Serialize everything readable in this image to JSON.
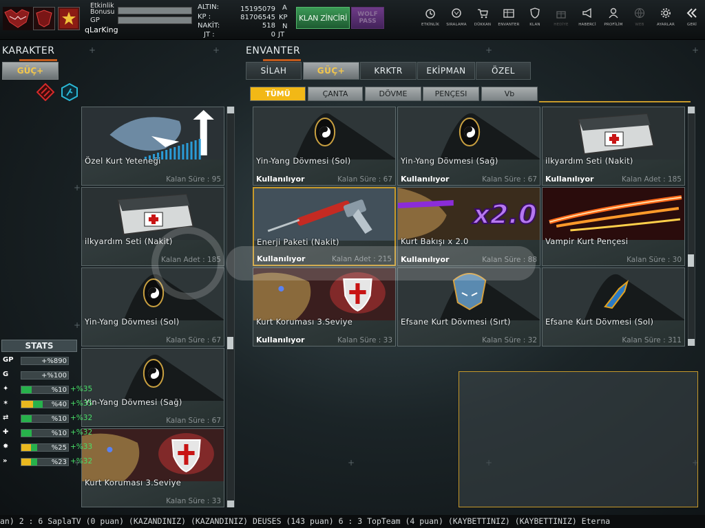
{
  "top": {
    "username": "qLarKing",
    "bonus_label_1": "Etkinlik",
    "bonus_label_2": "Bonusu",
    "gp_label": "GP",
    "currencies": [
      {
        "label": "ALTIN:",
        "value": "15195079",
        "unit": "A"
      },
      {
        "label": "KP :",
        "value": "81706545",
        "unit": "KP"
      },
      {
        "label": "NAKİT:",
        "value": "518",
        "unit": "N"
      },
      {
        "label": "JT :",
        "value": "0",
        "unit": "JT"
      }
    ],
    "klan_button": "KLAN ZİNCİRİ",
    "wolf_pass": "WOLF PASS",
    "nav": [
      {
        "label": "ETKİNLİK",
        "icon": "clock-icon",
        "dim": false
      },
      {
        "label": "SIRALAMA",
        "icon": "wolf-rank-icon",
        "dim": false
      },
      {
        "label": "DÜKKAN",
        "icon": "cart-icon",
        "dim": false
      },
      {
        "label": "ENVANTER",
        "icon": "inventory-icon",
        "dim": false
      },
      {
        "label": "KLAN",
        "icon": "shield-icon",
        "dim": false
      },
      {
        "label": "HEDİYE",
        "icon": "gift-icon",
        "dim": true
      },
      {
        "label": "HABERCİ",
        "icon": "megaphone-icon",
        "dim": false
      },
      {
        "label": "PROFİLİM",
        "icon": "profile-icon",
        "dim": false
      },
      {
        "label": "WEB",
        "icon": "globe-icon",
        "dim": true
      },
      {
        "label": "AYARLAR",
        "icon": "gear-icon",
        "dim": false
      },
      {
        "label": "GERİ",
        "icon": "back-icon",
        "dim": false
      }
    ]
  },
  "left": {
    "title": "KARAKTER",
    "guc_button": "GÜÇ+",
    "cards": [
      {
        "name": "Özel Kurt Yeteneği",
        "remain": "Kalan Süre : 95",
        "art": "wolf"
      },
      {
        "name": "ilkyardım Seti (Nakit)",
        "remain": "Kalan Adet : 185",
        "art": "kit"
      },
      {
        "name": "Yin-Yang Dövmesi (Sol)",
        "remain": "Kalan Süre : 67",
        "art": "yinyang"
      },
      {
        "name": "Yin-Yang Dövmesi (Sağ)",
        "remain": "Kalan Süre : 67",
        "art": "yinyang"
      },
      {
        "name": "Kurt Koruması 3.Seviye",
        "remain": "Kalan Süre : 33",
        "art": "shield"
      }
    ]
  },
  "stats": {
    "title": "STATS",
    "rows": [
      {
        "icon": "GP",
        "icon_name": "gp-icon",
        "value": "+%890",
        "green": 0,
        "yellow": 0,
        "extra": ""
      },
      {
        "icon": "G",
        "icon_name": "g-icon",
        "value": "+%100",
        "green": 0,
        "yellow": 0,
        "extra": ""
      },
      {
        "icon": "✦",
        "icon_name": "attack-stat-icon",
        "value": "%10",
        "green": 0.22,
        "yellow": 0,
        "extra": "+%35"
      },
      {
        "icon": "✶",
        "icon_name": "speed-stat-icon",
        "value": "%40",
        "green": 0.45,
        "yellow": 0.25,
        "extra": "+%35"
      },
      {
        "icon": "⇄",
        "icon_name": "swap-stat-icon",
        "value": "%10",
        "green": 0.22,
        "yellow": 0,
        "extra": "+%32"
      },
      {
        "icon": "✚",
        "icon_name": "heal-stat-icon",
        "value": "%10",
        "green": 0.22,
        "yellow": 0,
        "extra": "+%32"
      },
      {
        "icon": "✸",
        "icon_name": "burst-stat-icon",
        "value": "%25",
        "green": 0.34,
        "yellow": 0.2,
        "extra": "+%33"
      },
      {
        "icon": "»",
        "icon_name": "dash-stat-icon",
        "value": "%23",
        "green": 0.34,
        "yellow": 0.2,
        "extra": "+%32"
      }
    ]
  },
  "inventory": {
    "title": "ENVANTER",
    "tabs": [
      {
        "label": "SİLAH",
        "active": false
      },
      {
        "label": "GÜÇ+",
        "active": true
      },
      {
        "label": "KRKTR",
        "active": false
      },
      {
        "label": "EKİPMAN",
        "active": false
      },
      {
        "label": "ÖZEL",
        "active": false
      }
    ],
    "subtabs": [
      {
        "label": "TÜMÜ",
        "active": true
      },
      {
        "label": "ÇANTA",
        "active": false
      },
      {
        "label": "DÖVME",
        "active": false
      },
      {
        "label": "PENÇESI",
        "active": false
      },
      {
        "label": "Vb",
        "active": false
      }
    ],
    "items": [
      {
        "name": "Yin-Yang Dövmesi (Sol)",
        "status": "Kullanılıyor",
        "remain": "Kalan Süre : 67",
        "art": "yinyang",
        "selected": false
      },
      {
        "name": "Yin-Yang Dövmesi (Sağ)",
        "status": "Kullanılıyor",
        "remain": "Kalan Süre : 67",
        "art": "yinyang",
        "selected": false
      },
      {
        "name": "ilkyardım Seti (Nakit)",
        "status": "Kullanılıyor",
        "remain": "Kalan Adet : 185",
        "art": "kit",
        "selected": false
      },
      {
        "name": "Enerji Paketi (Nakit)",
        "status": "Kullanılıyor",
        "remain": "Kalan Adet : 215",
        "art": "injector",
        "selected": true
      },
      {
        "name": "Kurt Bakışı x 2.0",
        "status": "Kullanılıyor",
        "remain": "Kalan Süre : 88",
        "art": "x2",
        "selected": false
      },
      {
        "name": "Vampir Kurt Pençesi",
        "status": "",
        "remain": "Kalan Süre : 30",
        "art": "claw",
        "selected": false
      },
      {
        "name": "Kurt Koruması 3.Seviye",
        "status": "Kullanılıyor",
        "remain": "Kalan Süre : 33",
        "art": "shield",
        "selected": false
      },
      {
        "name": "Efsane Kurt Dövmesi (Sırt)",
        "status": "",
        "remain": "Kalan Süre : 32",
        "art": "wolfhead",
        "selected": false
      },
      {
        "name": "Efsane Kurt Dövmesi (Sol)",
        "status": "",
        "remain": "Kalan Süre : 311",
        "art": "blade",
        "selected": false
      }
    ],
    "x2_label": "x2.0"
  },
  "ticker": "an) 2 : 6 SaplaTV (0 puan) (KAZANDINIZ)    (KAZANDINIZ) DEUSES (143 puan) 6 : 3 TopTeam (4 puan) (KAYBETTINIZ)    (KAYBETTINIZ) Eterna",
  "colors": {
    "accent": "#f2b816",
    "green": "#27b14b",
    "selected_border": "#c89a2a"
  }
}
